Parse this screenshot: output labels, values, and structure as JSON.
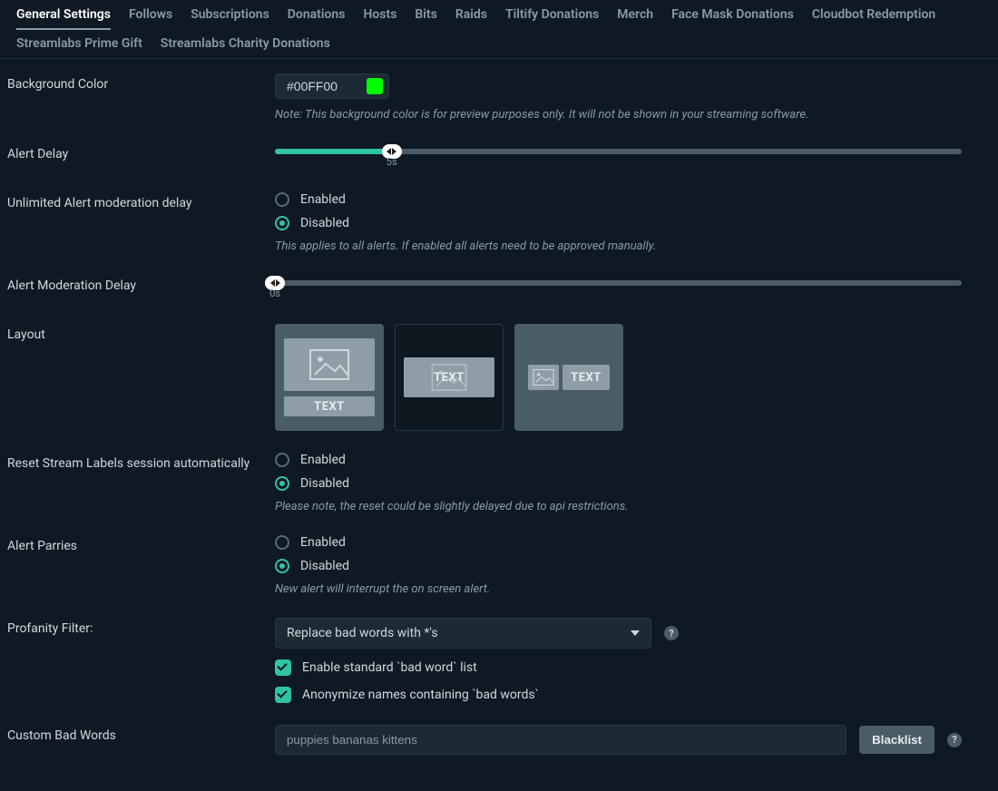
{
  "tabs": [
    {
      "label": "General Settings",
      "active": true
    },
    {
      "label": "Follows",
      "active": false
    },
    {
      "label": "Subscriptions",
      "active": false
    },
    {
      "label": "Donations",
      "active": false
    },
    {
      "label": "Hosts",
      "active": false
    },
    {
      "label": "Bits",
      "active": false
    },
    {
      "label": "Raids",
      "active": false
    },
    {
      "label": "Tiltify Donations",
      "active": false
    },
    {
      "label": "Merch",
      "active": false
    },
    {
      "label": "Face Mask Donations",
      "active": false
    },
    {
      "label": "Cloudbot Redemption",
      "active": false
    },
    {
      "label": "Streamlabs Prime Gift",
      "active": false
    },
    {
      "label": "Streamlabs Charity Donations",
      "active": false
    }
  ],
  "colors": {
    "accent": "#31c3a2",
    "swatch": "#00FF00"
  },
  "background_color": {
    "label": "Background Color",
    "value": "#00FF00",
    "note": "Note: This background color is for preview purposes only. It will not be shown in your streaming software."
  },
  "alert_delay": {
    "label": "Alert Delay",
    "value_seconds": 5,
    "display": "5s",
    "percent": 17
  },
  "unlimited_moderation": {
    "label": "Unlimited Alert moderation delay",
    "options": {
      "enabled": "Enabled",
      "disabled": "Disabled"
    },
    "selected": "disabled",
    "help": "This applies to all alerts. If enabled all alerts need to be approved manually."
  },
  "alert_moderation_delay": {
    "label": "Alert Moderation Delay",
    "value_seconds": 0,
    "display": "0s",
    "percent": 0
  },
  "layout": {
    "label": "Layout",
    "card_text": "TEXT",
    "selected_index": 0
  },
  "reset_stream_labels": {
    "label": "Reset Stream Labels session automatically",
    "options": {
      "enabled": "Enabled",
      "disabled": "Disabled"
    },
    "selected": "disabled",
    "help": "Please note, the reset could be slightly delayed due to api restrictions."
  },
  "alert_parries": {
    "label": "Alert Parries",
    "options": {
      "enabled": "Enabled",
      "disabled": "Disabled"
    },
    "selected": "disabled",
    "help": "New alert will interrupt the on screen alert."
  },
  "profanity_filter": {
    "label": "Profanity Filter:",
    "selected": "Replace bad words with *'s",
    "check1": "Enable standard `bad word` list",
    "check2": "Anonymize names containing `bad words`"
  },
  "custom_bad_words": {
    "label": "Custom Bad Words",
    "placeholder": "puppies bananas kittens",
    "button": "Blacklist"
  }
}
